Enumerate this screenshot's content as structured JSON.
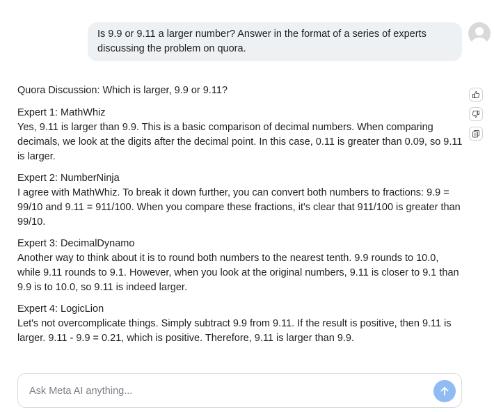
{
  "user_message": {
    "text": "Is 9.9 or 9.11 a larger number? Answer in the format of a series of experts discussing the problem on quora."
  },
  "response": {
    "heading": "Quora Discussion: Which is larger, 9.9 or 9.11?",
    "experts": [
      {
        "name": "Expert 1: MathWhiz",
        "text": "Yes, 9.11 is larger than 9.9. This is a basic comparison of decimal numbers. When comparing decimals, we look at the digits after the decimal point. In this case, 0.11 is greater than 0.09, so 9.11 is larger."
      },
      {
        "name": "Expert 2: NumberNinja",
        "text": "I agree with MathWhiz. To break it down further, you can convert both numbers to fractions: 9.9 = 99/10 and 9.11 = 911/100. When you compare these fractions, it's clear that 911/100 is greater than 99/10."
      },
      {
        "name": "Expert 3: DecimalDynamo",
        "text": "Another way to think about it is to round both numbers to the nearest tenth. 9.9 rounds to 10.0, while 9.11 rounds to 9.1. However, when you look at the original numbers, 9.11 is closer to 9.1 than 9.9 is to 10.0, so 9.11 is indeed larger."
      },
      {
        "name": "Expert 4: LogicLion",
        "text": "Let's not overcomplicate things. Simply subtract 9.9 from 9.11. If the result is positive, then 9.11 is larger. 9.11 - 9.9 = 0.21, which is positive. Therefore, 9.11 is larger than 9.9."
      }
    ]
  },
  "actions": {
    "icons": [
      "thumbs-up-icon",
      "thumbs-down-icon",
      "copy-icon"
    ]
  },
  "input": {
    "placeholder": "Ask Meta AI anything...",
    "value": ""
  },
  "send": {
    "icon": "arrow-up-icon"
  },
  "colors": {
    "user_bubble": "#eef1f4",
    "send_button": "#8fbcf2",
    "text": "#1c1e21",
    "placeholder": "#7a7f87"
  }
}
